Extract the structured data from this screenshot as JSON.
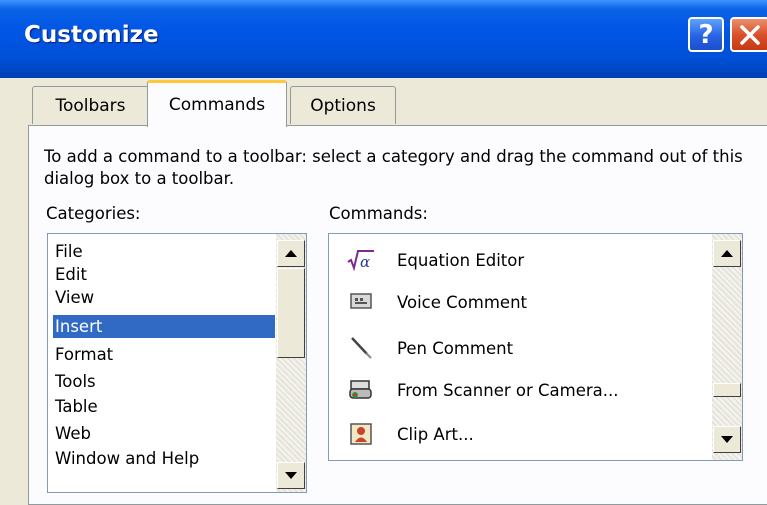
{
  "dialog": {
    "title": "Customize",
    "help_label": "?",
    "close_label": "✕"
  },
  "tabs": [
    {
      "label": "Toolbars",
      "active": false
    },
    {
      "label": "Commands",
      "active": true
    },
    {
      "label": "Options",
      "active": false
    }
  ],
  "instructions": "To add a command to a toolbar: select a category and drag the command out of this dialog box to a toolbar.",
  "categories": {
    "label": "Categories:",
    "items": [
      "File",
      "Edit",
      "View",
      "Insert",
      "Format",
      "Tools",
      "Table",
      "Web",
      "Window and Help"
    ],
    "selected": "Insert"
  },
  "commands": {
    "label": "Commands:",
    "items": [
      {
        "label": "Equation Editor",
        "icon": "equation-icon"
      },
      {
        "label": "Voice Comment",
        "icon": "voice-comment-icon"
      },
      {
        "label": "Pen Comment",
        "icon": "pen-icon"
      },
      {
        "label": "From Scanner or Camera...",
        "icon": "scanner-icon"
      },
      {
        "label": "Clip Art...",
        "icon": "clip-art-icon"
      }
    ]
  },
  "colors": {
    "title_bar": "#0055e5",
    "selection": "#316ac5",
    "tab_highlight": "#ffc83c",
    "close_button": "#d9522c"
  }
}
